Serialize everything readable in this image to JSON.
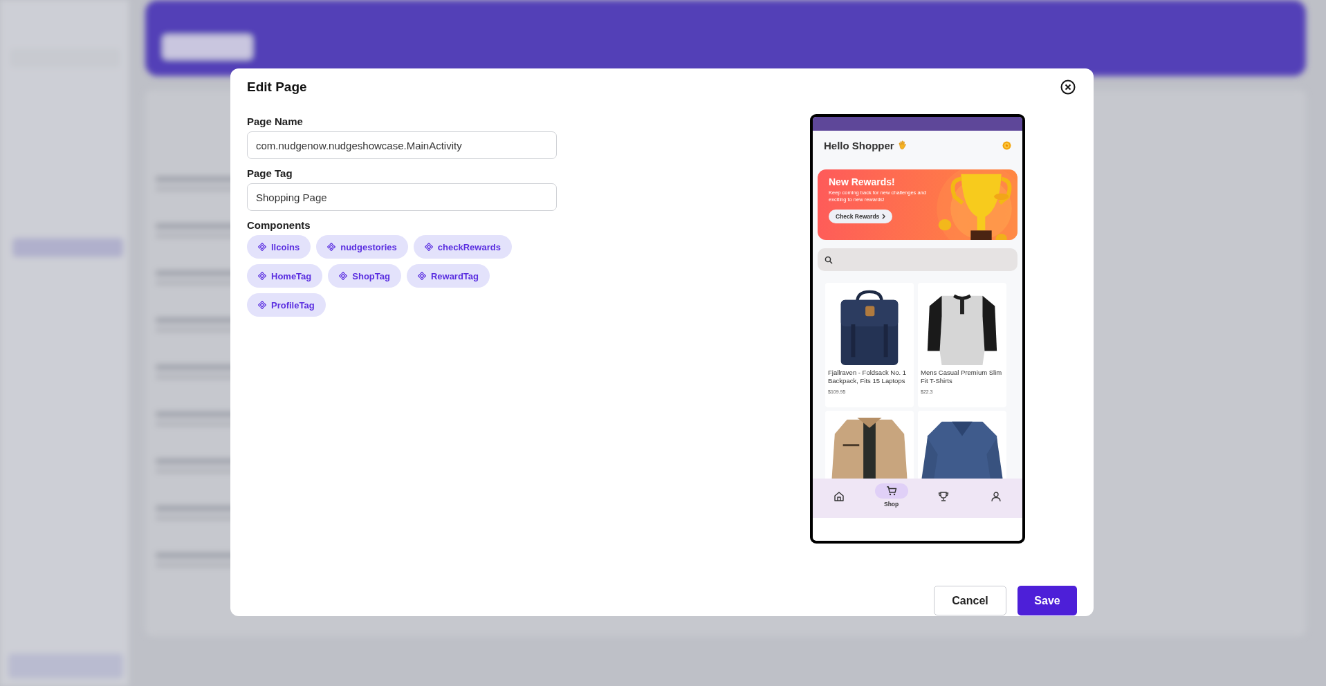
{
  "dialog": {
    "title": "Edit Page",
    "fields": [
      {
        "label": "Page Name",
        "value": "com.nudgenow.nudgeshowcase.MainActivity"
      },
      {
        "label": "Page Tag",
        "value": "Shopping Page"
      }
    ],
    "components_label": "Components",
    "components": [
      "llcoins",
      "nudgestories",
      "checkRewards",
      "HomeTag",
      "ShopTag",
      "RewardTag",
      "ProfileTag"
    ],
    "buttons": [
      {
        "label": "Cancel",
        "kind": "secondary"
      },
      {
        "label": "Save",
        "kind": "primary"
      }
    ]
  },
  "preview": {
    "greeting": "Hello Shopper",
    "banner": {
      "title": "New Rewards!",
      "text": "Keep coming back for new challenges and exciting to new rewards!",
      "button": "Check Rewards"
    },
    "products": [
      {
        "kind": "picture",
        "title": "Fjallraven - Foldsack No. 1 Backpack, Fits 15 Laptops",
        "price": "$109.95"
      },
      {
        "kind": "picture",
        "title": "Mens Casual Premium Slim Fit T-Shirts",
        "price": "$22.3"
      },
      {
        "kind": "picture"
      },
      {
        "kind": "picture"
      }
    ],
    "nav": [
      {
        "kind": "home",
        "selected": false
      },
      {
        "kind": "cart",
        "selected": true,
        "label": "Shop"
      },
      {
        "kind": "trophy",
        "selected": false
      },
      {
        "kind": "person",
        "selected": false
      }
    ]
  }
}
